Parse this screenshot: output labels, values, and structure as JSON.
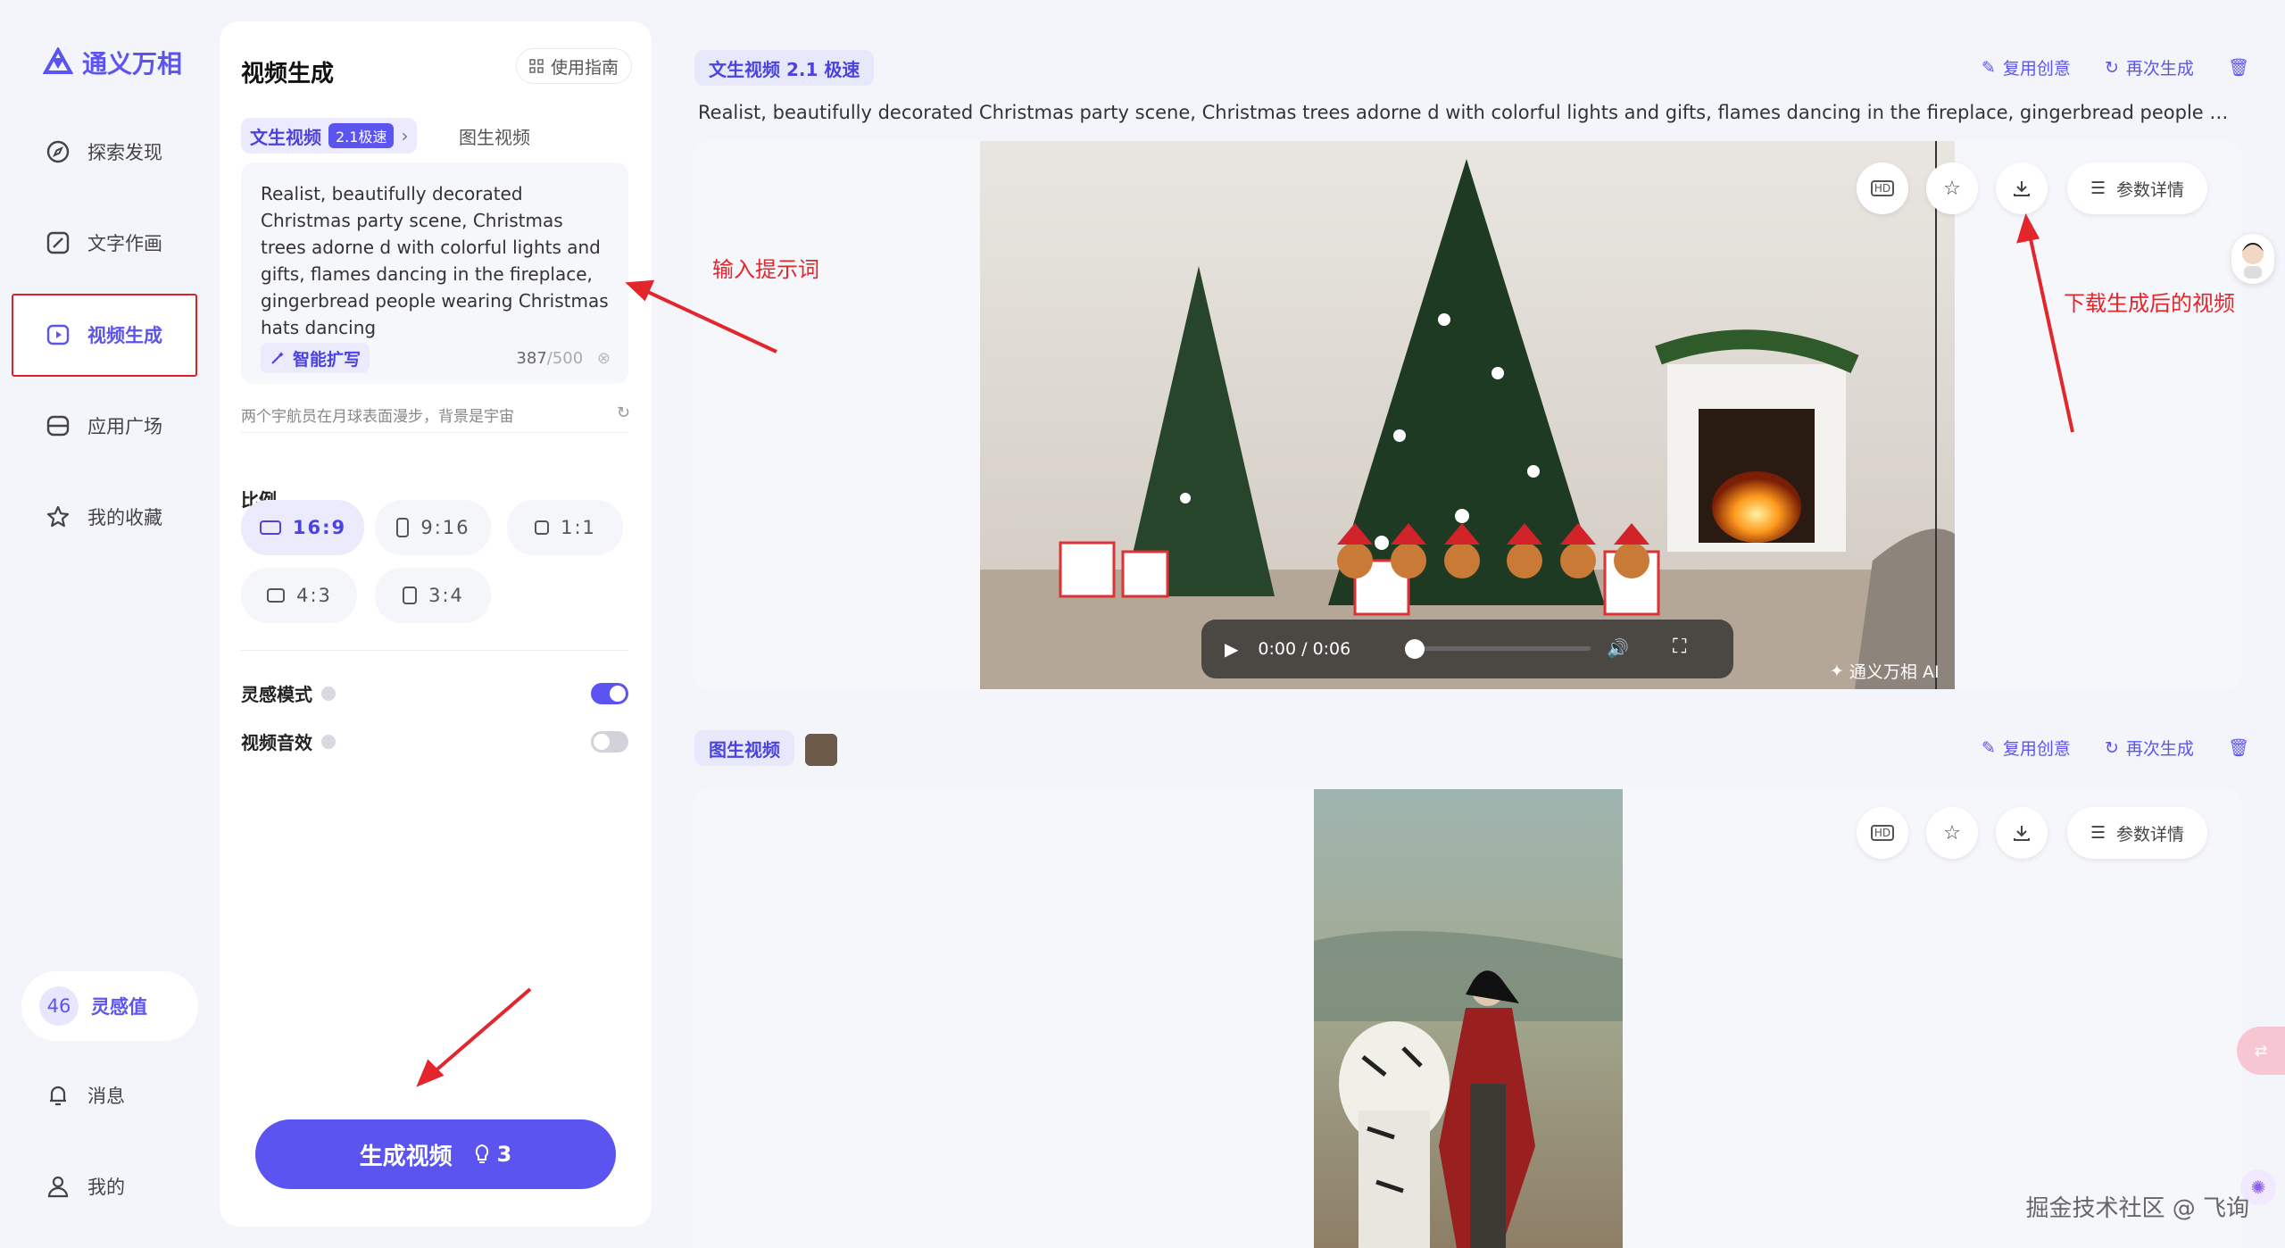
{
  "app": {
    "name": "通义万相"
  },
  "sidebar": {
    "items": [
      {
        "label": "探索发现",
        "icon": "compass-icon"
      },
      {
        "label": "文字作画",
        "icon": "image-edit-icon"
      },
      {
        "label": "视频生成",
        "icon": "video-play-icon",
        "active": true
      },
      {
        "label": "应用广场",
        "icon": "app-square-icon"
      },
      {
        "label": "我的收藏",
        "icon": "star-icon"
      }
    ],
    "credit": {
      "value": "46",
      "label": "灵感值"
    },
    "bottom": [
      {
        "label": "消息",
        "icon": "bell-icon"
      },
      {
        "label": "我的",
        "icon": "user-icon"
      }
    ]
  },
  "panel": {
    "title": "视频生成",
    "guide_label": "使用指南",
    "mode_tabs": [
      {
        "label": "文生视频",
        "badge": "2.1极速",
        "active": true
      },
      {
        "label": "图生视频"
      }
    ],
    "prompt": {
      "text": "Realist, beautifully decorated Christmas party scene, Christmas trees adorne d with colorful lights and gifts, flames dancing in the fireplace, gingerbread people wearing Christmas hats dancing",
      "expand_label": "智能扩写",
      "count": "387",
      "max": "/500"
    },
    "hint": "两个宇航员在月球表面漫步，背景是宇宙",
    "ratio_label": "比例",
    "ratios": [
      "16:9",
      "9:16",
      "1:1",
      "4:3",
      "3:4"
    ],
    "selected_ratio": "16:9",
    "toggles": [
      {
        "label": "灵感模式",
        "on": true
      },
      {
        "label": "视频音效",
        "on": false
      }
    ],
    "generate": {
      "label": "生成视频",
      "cost": "3"
    }
  },
  "results": [
    {
      "tag": "文生视频 2.1 极速",
      "actions": [
        "复用创意",
        "再次生成"
      ],
      "prompt": "Realist, beautifully decorated Christmas party scene, Christmas trees adorne d with colorful lights and gifts, flames dancing in the fireplace, gingerbread people wearing Christmas hats...",
      "params_label": "参数详情",
      "player": {
        "current": "0:00",
        "sep": "/",
        "duration": "0:06"
      },
      "logo_watermark": "通义万相 AI"
    },
    {
      "tag": "图生视频",
      "actions": [
        "复用创意",
        "再次生成"
      ],
      "params_label": "参数详情"
    }
  ],
  "annotations": {
    "prompt_hint": "输入提示词",
    "download_hint": "下载生成后的视频"
  },
  "footer_watermark": "掘金技术社区 @ 飞询",
  "colors": {
    "accent": "#5b54f0",
    "annotation": "#e3262b"
  }
}
